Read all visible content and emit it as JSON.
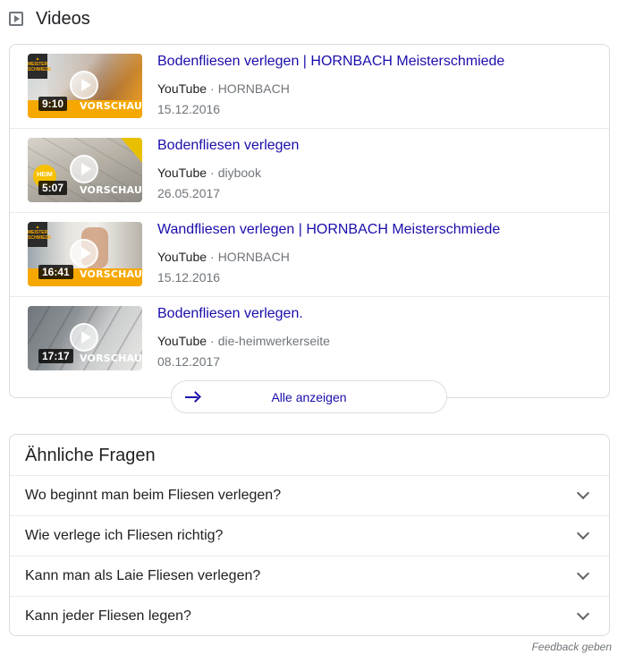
{
  "videos": {
    "header": "Videos",
    "items": [
      {
        "title": "Bodenfliesen verlegen | HORNBACH Meisterschmiede",
        "source": "YouTube",
        "channel": "HORNBACH",
        "date": "15.12.2016",
        "duration": "9:10",
        "preview": "VORSCHAU"
      },
      {
        "title": "Bodenfliesen verlegen",
        "source": "YouTube",
        "channel": "diybook",
        "date": "26.05.2017",
        "duration": "5:07",
        "preview": "VORSCHAU"
      },
      {
        "title": "Wandfliesen verlegen | HORNBACH Meisterschmiede",
        "source": "YouTube",
        "channel": "HORNBACH",
        "date": "15.12.2016",
        "duration": "16:41",
        "preview": "VORSCHAU"
      },
      {
        "title": "Bodenfliesen verlegen.",
        "source": "YouTube",
        "channel": "die-heimwerkerseite",
        "date": "08.12.2017",
        "duration": "17:17",
        "preview": "VORSCHAU"
      }
    ],
    "show_all": "Alle anzeigen"
  },
  "faq": {
    "title": "Ähnliche Fragen",
    "questions": [
      "Wo beginnt man beim Fliesen verlegen?",
      "Wie verlege ich Fliesen richtig?",
      "Kann man als Laie Fliesen verlegen?",
      "Kann jeder Fliesen legen?"
    ]
  },
  "feedback": "Feedback geben",
  "colors": {
    "link": "#1a0dab",
    "meta": "#70757a",
    "border": "#dadce0",
    "accent_orange": "#f6a800"
  }
}
